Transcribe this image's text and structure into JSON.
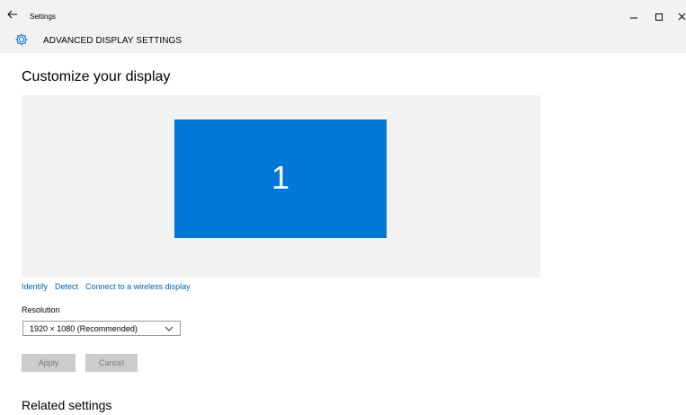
{
  "window": {
    "title": "Settings"
  },
  "header": {
    "title": "ADVANCED DISPLAY SETTINGS",
    "icon": "gear-icon"
  },
  "main": {
    "page_title": "Customize your display",
    "display_preview": {
      "monitor_number": "1",
      "monitor_color": "#0078d7"
    },
    "links": {
      "identify": "Identify",
      "detect": "Detect",
      "wireless": "Connect to a wireless display"
    },
    "resolution": {
      "label": "Resolution",
      "selected": "1920 × 1080 (Recommended)"
    },
    "buttons": {
      "apply": "Apply",
      "cancel": "Cancel"
    },
    "related_title": "Related settings"
  },
  "colors": {
    "accent": "#0078d7",
    "link": "#0063b1",
    "chrome": "#f2f2f2"
  }
}
